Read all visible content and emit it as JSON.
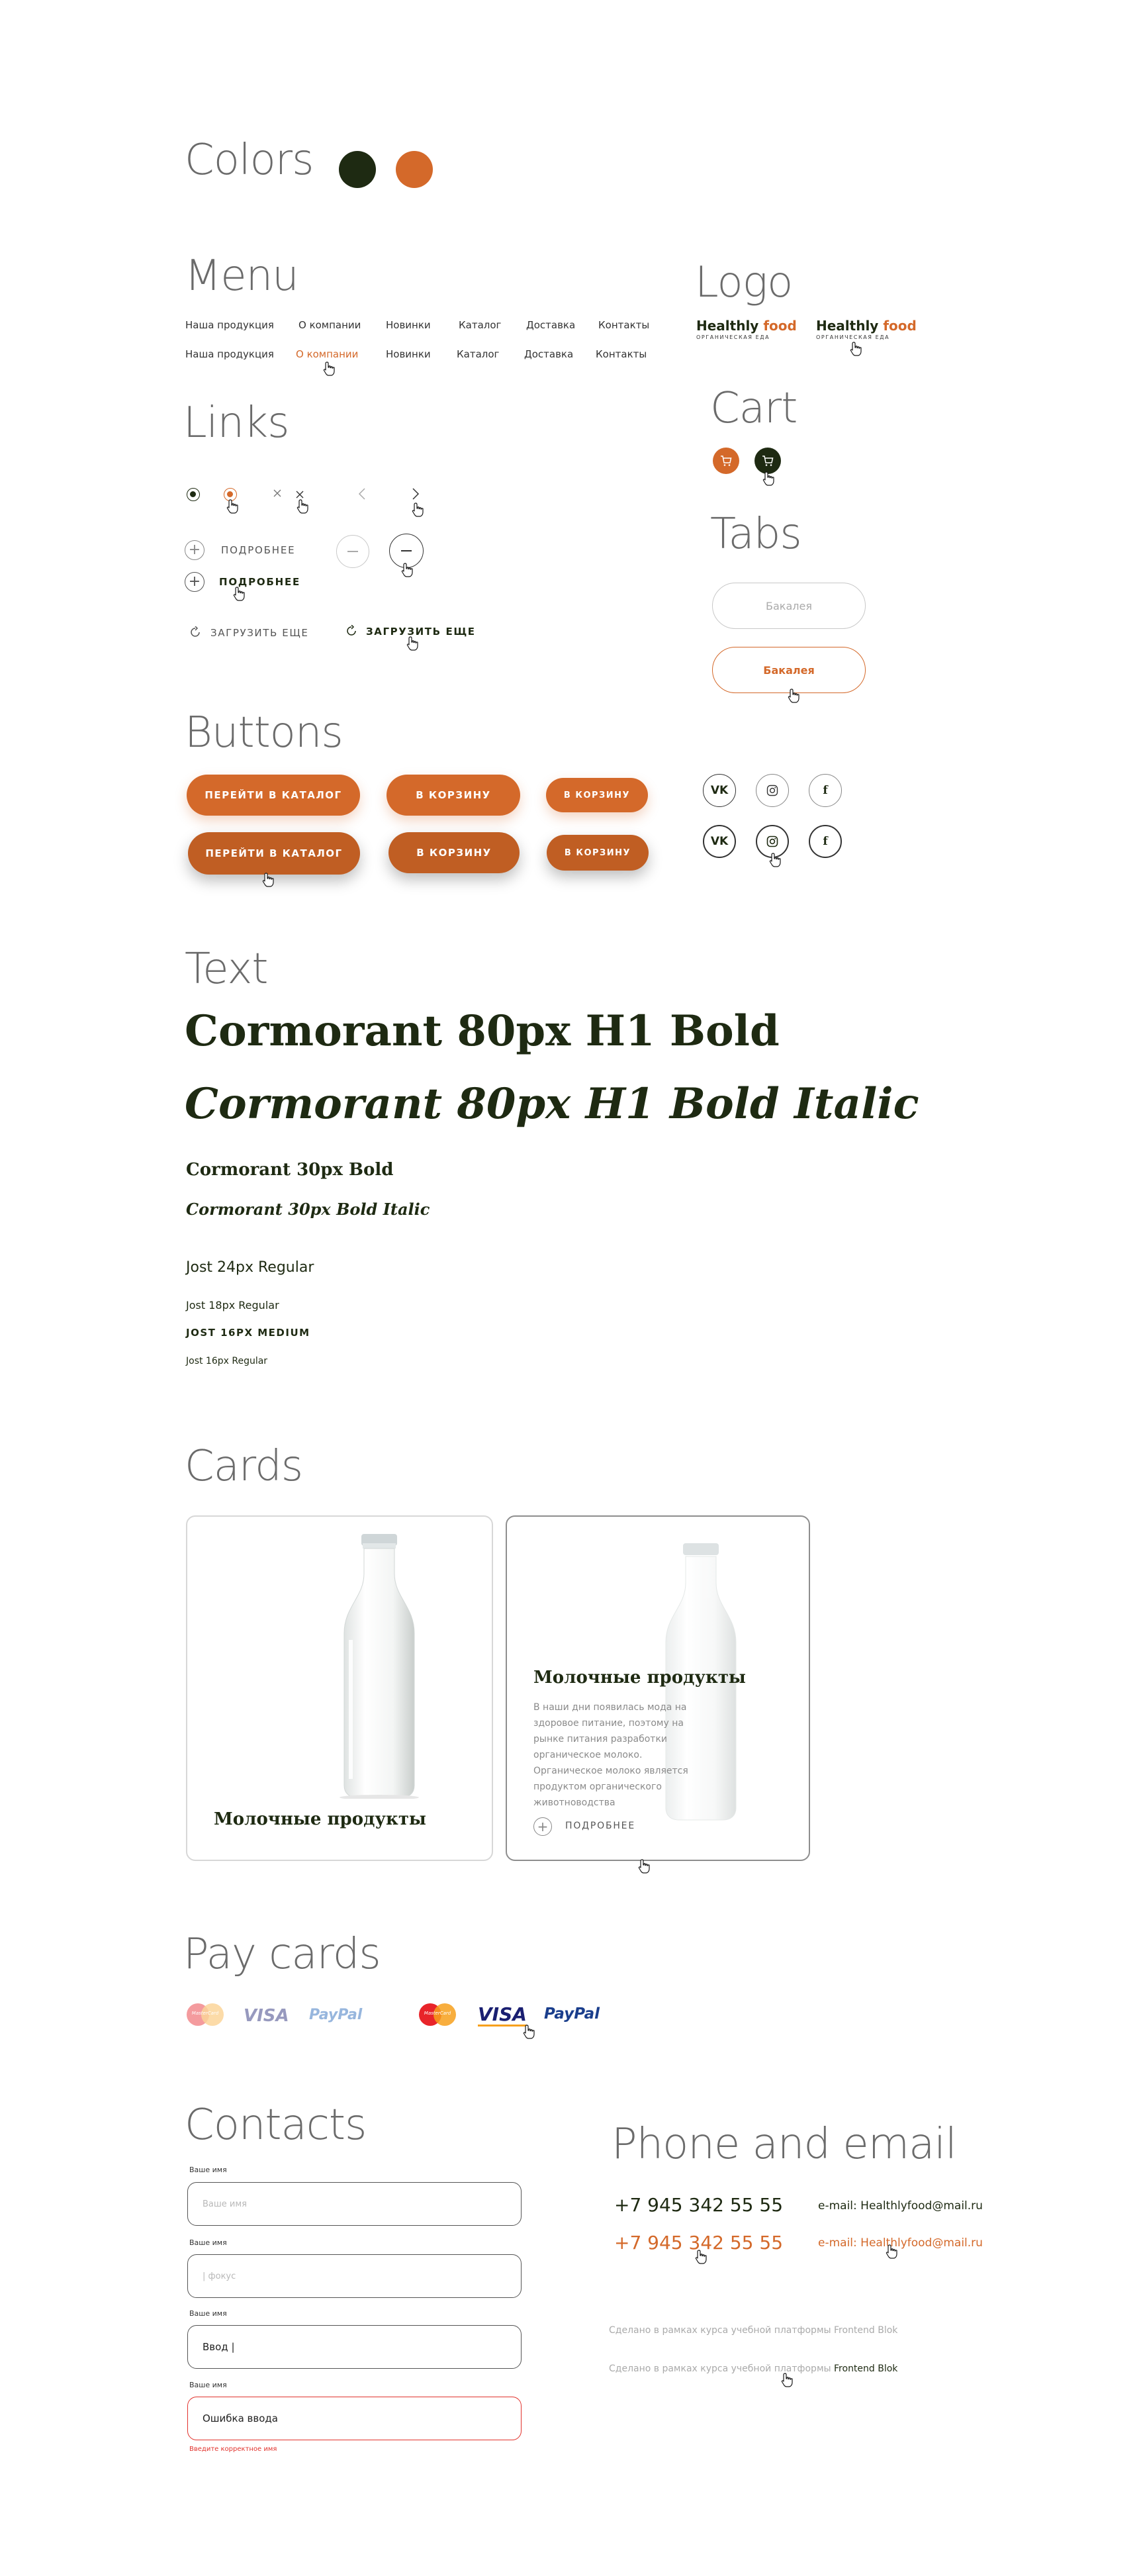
{
  "sections": {
    "colors": "Colors",
    "menu": "Menu",
    "logo": "Logo",
    "links": "Links",
    "cart": "Cart",
    "tabs": "Tabs",
    "buttons": "Buttons",
    "text": "Text",
    "cards": "Cards",
    "pay_cards": "Pay cards",
    "contacts": "Contacts",
    "phone_email": "Phone and email"
  },
  "palette": {
    "dark": "#1e2a12",
    "accent": "#d4692a"
  },
  "menu": {
    "items": [
      "Наша продукция",
      "О компании",
      "Новинки",
      "Каталог",
      "Доставка",
      "Контакты"
    ],
    "active_index": 1
  },
  "logo": {
    "word1": "Healthly",
    "word2": "food",
    "tagline": "ОРГАНИЧЕСКАЯ ЕДА"
  },
  "links": {
    "more": "ПОДРОБНЕЕ",
    "load_more": "ЗАГРУЗИТЬ ЕЩЕ"
  },
  "tabs": {
    "label": "Бакалея"
  },
  "buttons": {
    "catalog": "ПЕРЕЙТИ В КАТАЛОГ",
    "cart": "В КОРЗИНУ",
    "cart_small": "В КОРЗИНУ"
  },
  "social": {
    "vk": "VK",
    "instagram": "instagram-icon",
    "facebook": "f"
  },
  "text_samples": {
    "h1": "Cormorant 80px H1 Bold",
    "h1_italic": "Cormorant 80px H1 Bold Italic",
    "h3": "Cormorant 30px Bold",
    "h3_italic": "Cormorant 30px Bold Italic",
    "jost24": "Jost 24px Regular",
    "jost18": "Jost 18px Regular",
    "jost16m": "JOST 16PX MEDIUM",
    "jost16": "Jost 16px Regular"
  },
  "cards": {
    "title": "Молочные продукты",
    "description": "В наши дни появилась мода на здоровое питание, поэтому на рынке питания разработки органическое молоко. Органическое молоко является продуктом органического животноводства",
    "more": "ПОДРОБНЕЕ"
  },
  "pay_cards": {
    "mastercard": "MasterCard",
    "visa": "VISA",
    "paypal": "PayPal"
  },
  "contacts": {
    "label": "Ваше имя",
    "placeholder": "Ваше имя",
    "focus_placeholder": "| фокус",
    "typed": "Ввод |",
    "error_value": "Ошибка ввода",
    "error_message": "Введите корректное имя"
  },
  "phone_email": {
    "phone": "+7 945 342 55 55",
    "email_prefix": "e-mail:",
    "email": "Healthlyfood@mail.ru",
    "credit_text": "Сделано в рамках курса учебной платформы",
    "credit_brand": "Frontend Blok"
  }
}
